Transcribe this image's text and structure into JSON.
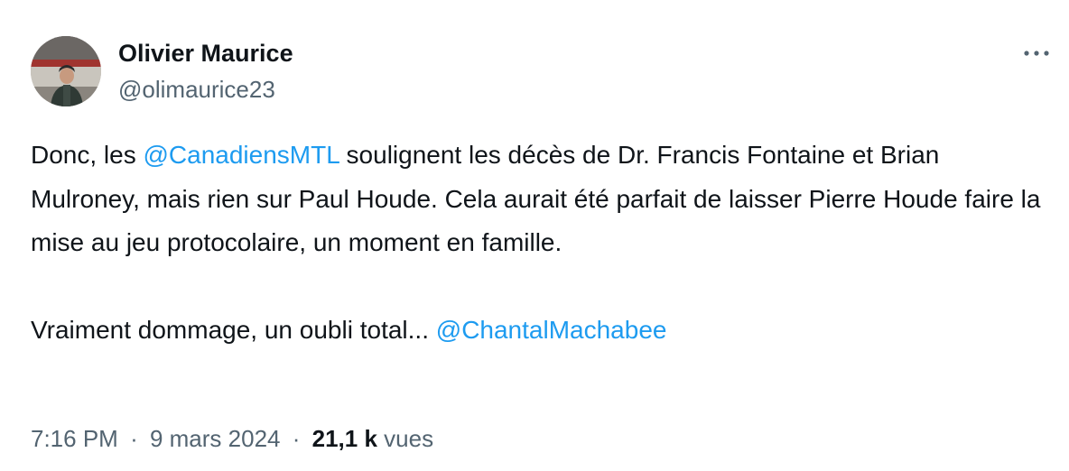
{
  "author": {
    "name": "Olivier Maurice",
    "handle": "@olimaurice23"
  },
  "tweet": {
    "p1_t1": "Donc, les ",
    "p1_mention": "@CanadiensMTL",
    "p1_t2": " soulignent les décès de Dr. Francis Fontaine et Brian Mulroney, mais rien sur Paul Houde. Cela aurait été parfait de laisser Pierre Houde faire la mise au jeu protocolaire, un moment en famille.",
    "p2_t1": "Vraiment dommage, un oubli total... ",
    "p2_mention": "@ChantalMachabee"
  },
  "meta": {
    "time": "7:16 PM",
    "date": "9 mars 2024",
    "separator": "·",
    "views_count": "21,1 k",
    "views_label": "vues"
  },
  "icons": {
    "more": "more-horizontal-icon"
  },
  "colors": {
    "text": "#0f1419",
    "secondary": "#536471",
    "link": "#1d9bf0"
  }
}
